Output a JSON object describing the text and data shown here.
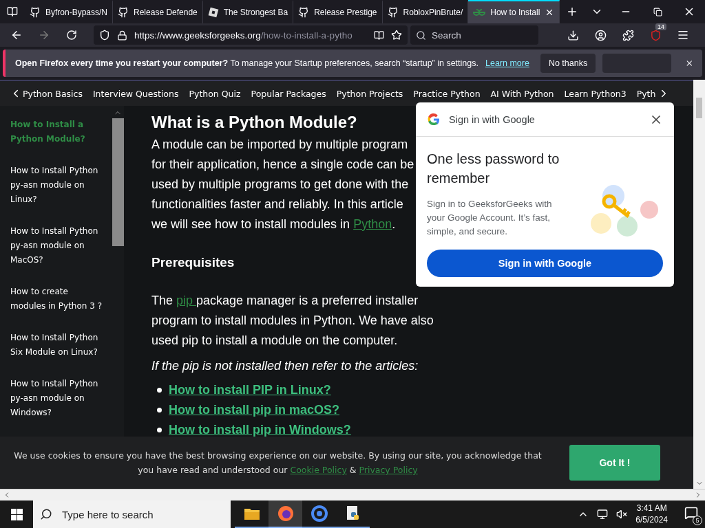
{
  "browser": {
    "tabs": [
      {
        "title": "Byfron-Bypass/N",
        "kind": "github",
        "selected": false
      },
      {
        "title": "Release Defende",
        "kind": "github",
        "selected": false
      },
      {
        "title": "The Strongest Ba",
        "kind": "roblox",
        "selected": false
      },
      {
        "title": "Release Prestige",
        "kind": "github",
        "selected": false
      },
      {
        "title": "RobloxPinBrute/",
        "kind": "github",
        "selected": false
      },
      {
        "title": "How to Install",
        "kind": "gfg",
        "selected": true
      }
    ],
    "url_host": "https://www.geeksforgeeks.org",
    "url_path": "/how-to-install-a-pytho",
    "search_placeholder": "Search",
    "extension_badge": "14"
  },
  "notification": {
    "bold": "Open Firefox every time you restart your computer?",
    "text": "To manage your Startup preferences, search “startup” in settings.",
    "link": "Learn more",
    "button": "No thanks"
  },
  "site_nav": {
    "items": [
      "Python Basics",
      "Interview Questions",
      "Python Quiz",
      "Popular Packages",
      "Python Projects",
      "Practice Python",
      "AI With Python",
      "Learn Python3",
      "Pyth"
    ]
  },
  "sidebar": {
    "items": [
      {
        "label": "How to Install a Python Module?",
        "selected": true
      },
      {
        "label": "How to Install Python py-asn module on Linux?",
        "selected": false
      },
      {
        "label": "How to Install Python py-asn module on MacOS?",
        "selected": false
      },
      {
        "label": "How to create modules in Python 3 ?",
        "selected": false
      },
      {
        "label": "How to Install Python Six Module on Linux?",
        "selected": false
      },
      {
        "label": "How to Install Python py-asn module on Windows?",
        "selected": false
      }
    ]
  },
  "article": {
    "heading": "What is a Python Module?",
    "intro_lines": [
      "A module can be imported by multiple program",
      "for their application, hence a single code can be",
      "used by multiple programs to get done with the",
      "functionalities faster and reliably. In this article"
    ],
    "intro_last": "we will see how to install modules in ",
    "intro_link": "Python",
    "intro_end": ".",
    "subheading": "Prerequisites",
    "para_start": "The ",
    "para_link": "pip ",
    "para_rest": "package manager is a preferred installer program to install modules in Python. We have also used pip to install a module on the computer.",
    "note": "If the pip is not installed then refer to the articles:",
    "links": [
      "How to install PIP in Linux?",
      "How to install pip in macOS?",
      "How to install pip in Windows?"
    ]
  },
  "popup": {
    "title": "Sign in with Google",
    "headline": "One less password to remember",
    "body": "Sign in to GeeksforGeeks with your Google Account. It’s fast, simple, and secure.",
    "button": "Sign in with Google"
  },
  "cookie": {
    "text": "We use cookies to ensure you have the best browsing experience on our website. By using our site, you acknowledge that you have read and understood our ",
    "link1": "Cookie Policy",
    "sep": " & ",
    "link2": "Privacy Policy",
    "button": "Got It !"
  },
  "taskbar": {
    "search_placeholder": "Type here to search",
    "apps": [
      {
        "kind": "folder",
        "selected": false
      },
      {
        "kind": "firefox",
        "selected": true
      },
      {
        "kind": "chrome",
        "selected": false
      },
      {
        "kind": "python",
        "selected": false
      }
    ],
    "time": "3:41 AM",
    "date": "6/5/2024",
    "notifications": "5"
  }
}
